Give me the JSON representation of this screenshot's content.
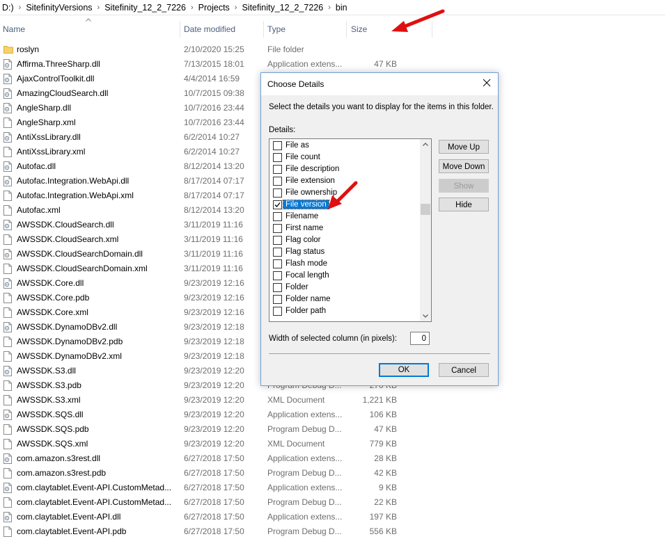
{
  "breadcrumb": [
    "D:)",
    "SitefinityVersions",
    "Sitefinity_12_2_7226",
    "Projects",
    "Sitefinity_12_2_7226",
    "bin"
  ],
  "columns": {
    "name": "Name",
    "date": "Date modified",
    "type": "Type",
    "size": "Size"
  },
  "files": [
    {
      "name": "roslyn",
      "date": "2/10/2020 15:25",
      "type": "File folder",
      "size": "",
      "icon": "folder-icon"
    },
    {
      "name": "Affirma.ThreeSharp.dll",
      "date": "7/13/2015 18:01",
      "type": "Application extens...",
      "size": "47 KB",
      "icon": "dll-file-icon"
    },
    {
      "name": "AjaxControlToolkit.dll",
      "date": "4/4/2014 16:59",
      "type": "",
      "size": "",
      "icon": "dll-file-icon"
    },
    {
      "name": "AmazingCloudSearch.dll",
      "date": "10/7/2015 09:38",
      "type": "",
      "size": "",
      "icon": "dll-file-icon"
    },
    {
      "name": "AngleSharp.dll",
      "date": "10/7/2016 23:44",
      "type": "",
      "size": "",
      "icon": "dll-file-icon"
    },
    {
      "name": "AngleSharp.xml",
      "date": "10/7/2016 23:44",
      "type": "",
      "size": "",
      "icon": "file-icon"
    },
    {
      "name": "AntiXssLibrary.dll",
      "date": "6/2/2014 10:27",
      "type": "",
      "size": "",
      "icon": "dll-file-icon"
    },
    {
      "name": "AntiXssLibrary.xml",
      "date": "6/2/2014 10:27",
      "type": "",
      "size": "",
      "icon": "file-icon"
    },
    {
      "name": "Autofac.dll",
      "date": "8/12/2014 13:20",
      "type": "",
      "size": "",
      "icon": "dll-file-icon"
    },
    {
      "name": "Autofac.Integration.WebApi.dll",
      "date": "8/17/2014 07:17",
      "type": "",
      "size": "",
      "icon": "dll-file-icon"
    },
    {
      "name": "Autofac.Integration.WebApi.xml",
      "date": "8/17/2014 07:17",
      "type": "",
      "size": "",
      "icon": "file-icon"
    },
    {
      "name": "Autofac.xml",
      "date": "8/12/2014 13:20",
      "type": "",
      "size": "",
      "icon": "file-icon"
    },
    {
      "name": "AWSSDK.CloudSearch.dll",
      "date": "3/11/2019 11:16",
      "type": "",
      "size": "",
      "icon": "dll-file-icon"
    },
    {
      "name": "AWSSDK.CloudSearch.xml",
      "date": "3/11/2019 11:16",
      "type": "",
      "size": "",
      "icon": "file-icon"
    },
    {
      "name": "AWSSDK.CloudSearchDomain.dll",
      "date": "3/11/2019 11:16",
      "type": "",
      "size": "",
      "icon": "dll-file-icon"
    },
    {
      "name": "AWSSDK.CloudSearchDomain.xml",
      "date": "3/11/2019 11:16",
      "type": "",
      "size": "",
      "icon": "file-icon"
    },
    {
      "name": "AWSSDK.Core.dll",
      "date": "9/23/2019 12:16",
      "type": "",
      "size": "",
      "icon": "dll-file-icon"
    },
    {
      "name": "AWSSDK.Core.pdb",
      "date": "9/23/2019 12:16",
      "type": "",
      "size": "",
      "icon": "file-icon"
    },
    {
      "name": "AWSSDK.Core.xml",
      "date": "9/23/2019 12:16",
      "type": "",
      "size": "",
      "icon": "file-icon"
    },
    {
      "name": "AWSSDK.DynamoDBv2.dll",
      "date": "9/23/2019 12:18",
      "type": "",
      "size": "",
      "icon": "dll-file-icon"
    },
    {
      "name": "AWSSDK.DynamoDBv2.pdb",
      "date": "9/23/2019 12:18",
      "type": "",
      "size": "",
      "icon": "file-icon"
    },
    {
      "name": "AWSSDK.DynamoDBv2.xml",
      "date": "9/23/2019 12:18",
      "type": "",
      "size": "",
      "icon": "file-icon"
    },
    {
      "name": "AWSSDK.S3.dll",
      "date": "9/23/2019 12:20",
      "type": "",
      "size": "",
      "icon": "dll-file-icon"
    },
    {
      "name": "AWSSDK.S3.pdb",
      "date": "9/23/2019 12:20",
      "type": "Program Debug D...",
      "size": "270 KB",
      "icon": "file-icon"
    },
    {
      "name": "AWSSDK.S3.xml",
      "date": "9/23/2019 12:20",
      "type": "XML Document",
      "size": "1,221 KB",
      "icon": "file-icon"
    },
    {
      "name": "AWSSDK.SQS.dll",
      "date": "9/23/2019 12:20",
      "type": "Application extens...",
      "size": "106 KB",
      "icon": "dll-file-icon"
    },
    {
      "name": "AWSSDK.SQS.pdb",
      "date": "9/23/2019 12:20",
      "type": "Program Debug D...",
      "size": "47 KB",
      "icon": "file-icon"
    },
    {
      "name": "AWSSDK.SQS.xml",
      "date": "9/23/2019 12:20",
      "type": "XML Document",
      "size": "779 KB",
      "icon": "file-icon"
    },
    {
      "name": "com.amazon.s3rest.dll",
      "date": "6/27/2018 17:50",
      "type": "Application extens...",
      "size": "28 KB",
      "icon": "dll-file-icon"
    },
    {
      "name": "com.amazon.s3rest.pdb",
      "date": "6/27/2018 17:50",
      "type": "Program Debug D...",
      "size": "42 KB",
      "icon": "file-icon"
    },
    {
      "name": "com.claytablet.Event-API.CustomMetad...",
      "date": "6/27/2018 17:50",
      "type": "Application extens...",
      "size": "9 KB",
      "icon": "dll-file-icon"
    },
    {
      "name": "com.claytablet.Event-API.CustomMetad...",
      "date": "6/27/2018 17:50",
      "type": "Program Debug D...",
      "size": "22 KB",
      "icon": "file-icon"
    },
    {
      "name": "com.claytablet.Event-API.dll",
      "date": "6/27/2018 17:50",
      "type": "Application extens...",
      "size": "197 KB",
      "icon": "dll-file-icon"
    },
    {
      "name": "com.claytablet.Event-API.pdb",
      "date": "6/27/2018 17:50",
      "type": "Program Debug D...",
      "size": "556 KB",
      "icon": "file-icon"
    }
  ],
  "dialog": {
    "title": "Choose Details",
    "description": "Select the details you want to display for the items in this folder.",
    "details_label": "Details:",
    "items": [
      {
        "label": "File as",
        "checked": false
      },
      {
        "label": "File count",
        "checked": false
      },
      {
        "label": "File description",
        "checked": false
      },
      {
        "label": "File extension",
        "checked": false
      },
      {
        "label": "File ownership",
        "checked": false
      },
      {
        "label": "File version",
        "checked": true,
        "selected": true
      },
      {
        "label": "Filename",
        "checked": false
      },
      {
        "label": "First name",
        "checked": false
      },
      {
        "label": "Flag color",
        "checked": false
      },
      {
        "label": "Flag status",
        "checked": false
      },
      {
        "label": "Flash mode",
        "checked": false
      },
      {
        "label": "Focal length",
        "checked": false
      },
      {
        "label": "Folder",
        "checked": false
      },
      {
        "label": "Folder name",
        "checked": false
      },
      {
        "label": "Folder path",
        "checked": false
      }
    ],
    "buttons": {
      "move_up": "Move Up",
      "move_down": "Move Down",
      "show": "Show",
      "hide": "Hide",
      "ok": "OK",
      "cancel": "Cancel"
    },
    "width_label": "Width of selected column (in pixels):",
    "width_value": "0"
  },
  "colors": {
    "accent": "#0078d7",
    "arrow": "#e01010",
    "header_text": "#4c607a",
    "secondary_text": "#6d6d6d"
  }
}
